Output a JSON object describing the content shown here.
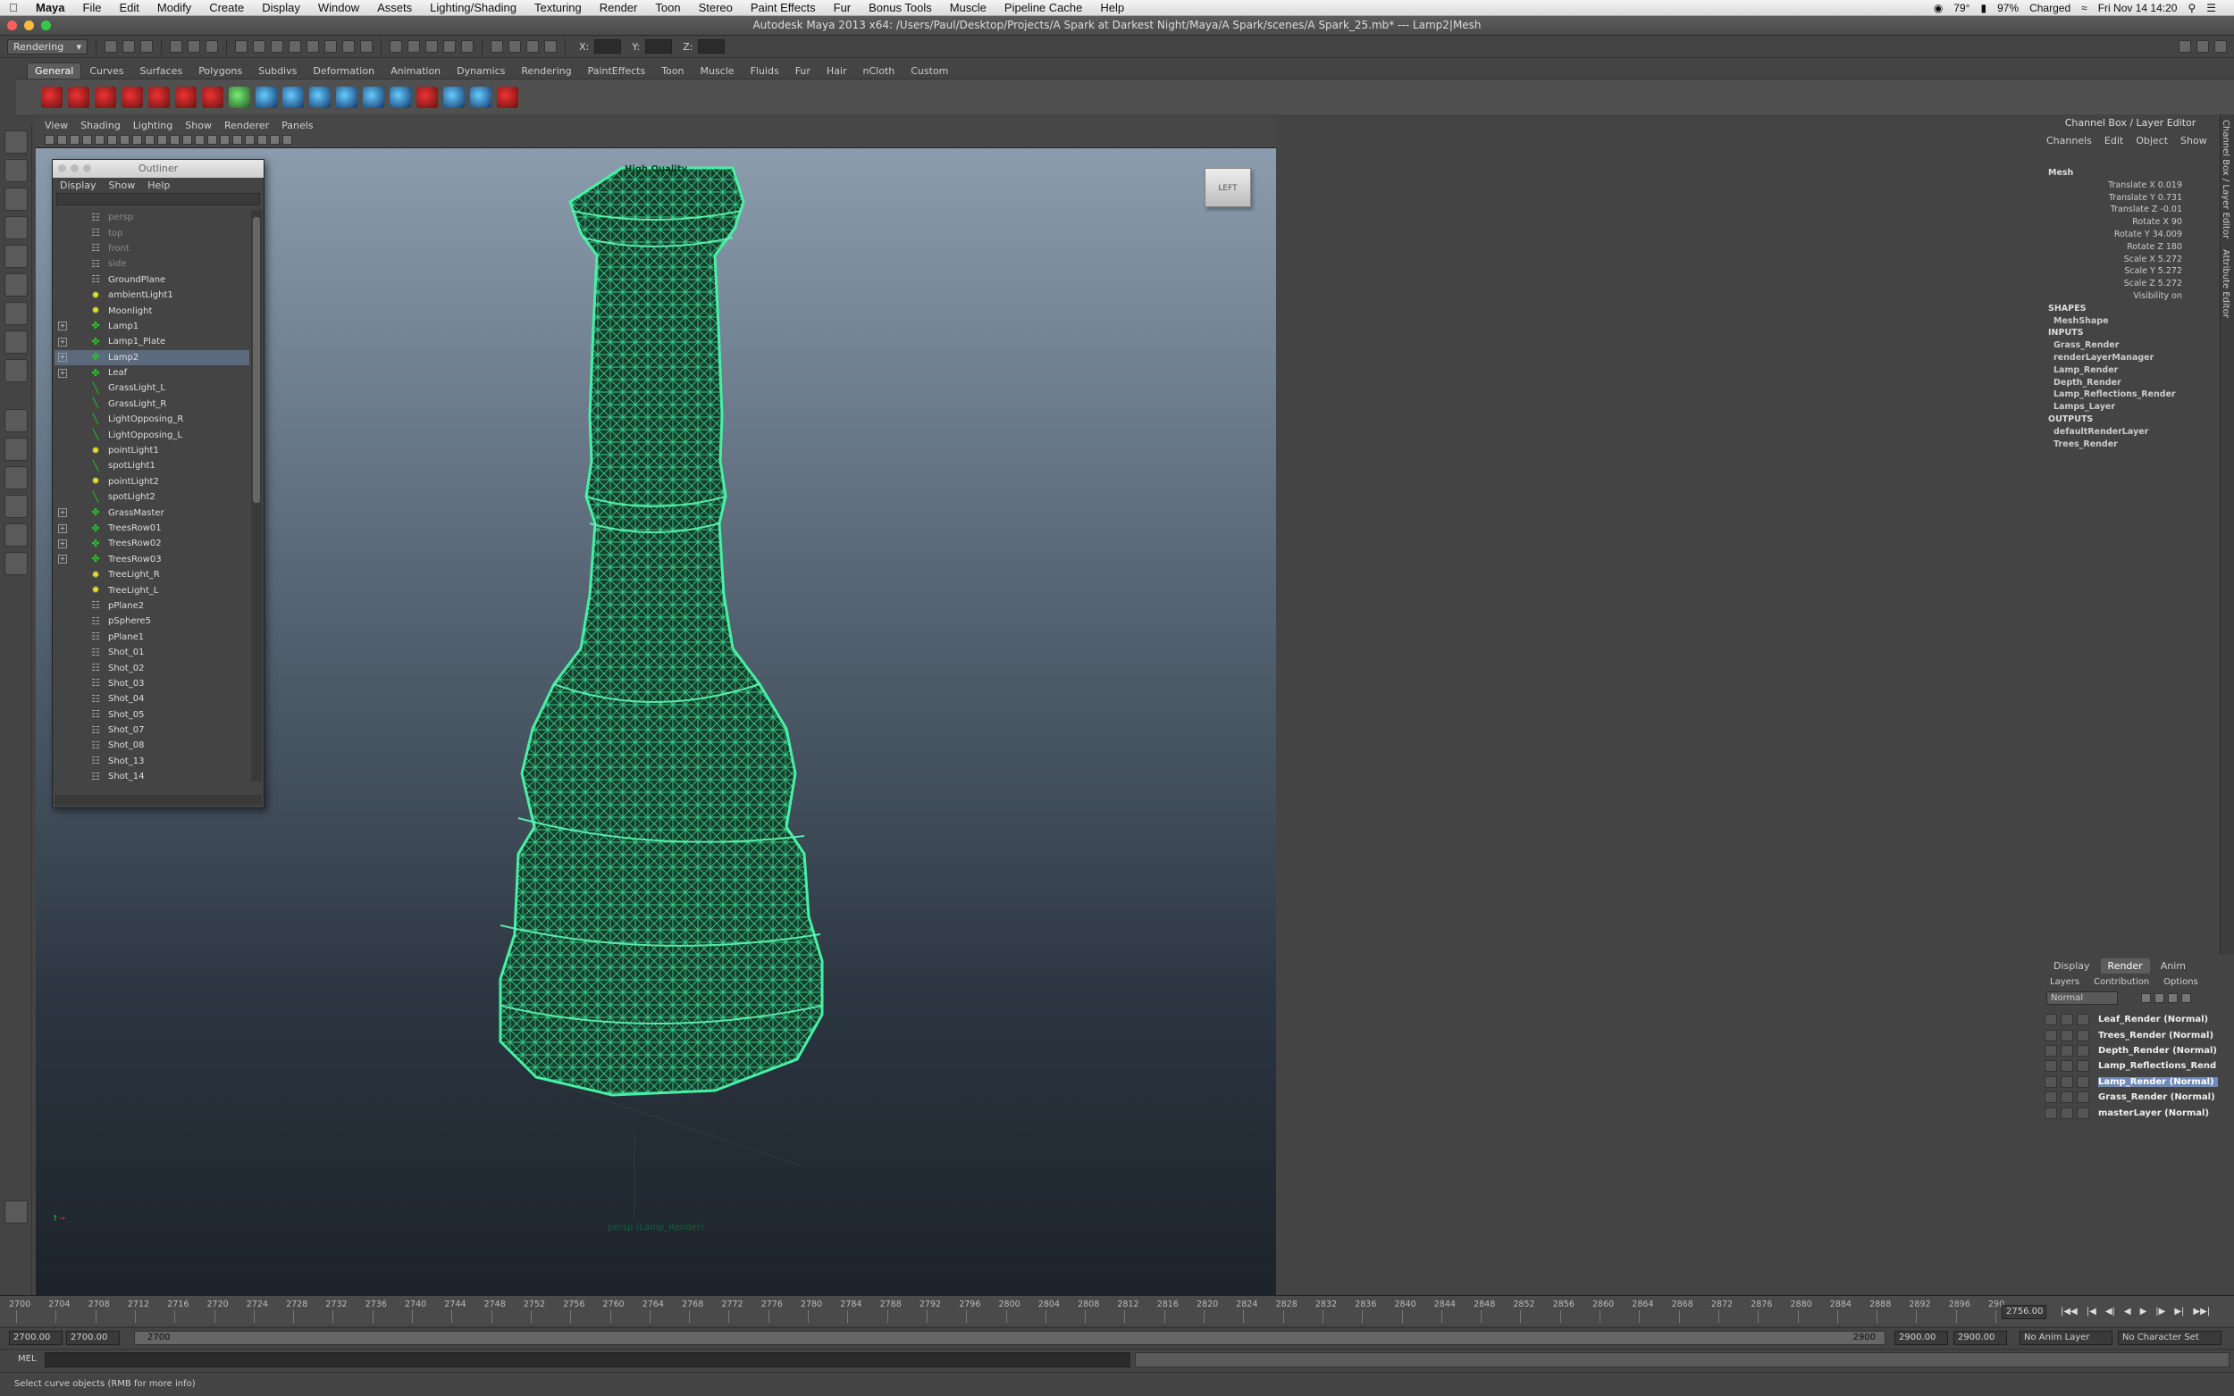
{
  "macos": {
    "app_name": "Maya",
    "menus": [
      "File",
      "Edit",
      "Modify",
      "Create",
      "Display",
      "Window",
      "Assets",
      "Lighting/Shading",
      "Texturing",
      "Render",
      "Toon",
      "Stereo",
      "Paint Effects",
      "Fur",
      "Bonus Tools",
      "Muscle",
      "Pipeline Cache",
      "Help"
    ],
    "temp": "79°",
    "battery": "97%",
    "battery_state": "Charged",
    "clock": "Fri Nov 14  14:20"
  },
  "window": {
    "title": "Autodesk Maya 2013 x64: /Users/Paul/Desktop/Projects/A Spark at Darkest Night/Maya/A Spark/scenes/A Spark_25.mb*   ---   Lamp2|Mesh",
    "colors": {
      "close": "#fc605c",
      "minimize": "#fdbc40",
      "zoom": "#34c84a"
    }
  },
  "status_line": {
    "menu_set": "Rendering",
    "x_label": "X:",
    "y_label": "Y:",
    "z_label": "Z:"
  },
  "shelf_tabs": [
    "General",
    "Curves",
    "Surfaces",
    "Polygons",
    "Subdivs",
    "Deformation",
    "Animation",
    "Dynamics",
    "Rendering",
    "PaintEffects",
    "Toon",
    "Muscle",
    "Fluids",
    "Fur",
    "Hair",
    "nCloth",
    "Custom"
  ],
  "viewport": {
    "menus": [
      "View",
      "Shading",
      "Lighting",
      "Show",
      "Renderer",
      "Panels"
    ],
    "hq_label": "High Quality",
    "viewcube_label": "LEFT",
    "camera_label": "persp (Lamp_Render)",
    "wire_color": "#3ee89a"
  },
  "outliner": {
    "title": "Outliner",
    "menus": [
      "Display",
      "Show",
      "Help"
    ],
    "items": [
      {
        "name": "persp",
        "icon": "cam",
        "exp": false,
        "dim": true
      },
      {
        "name": "top",
        "icon": "cam",
        "exp": false,
        "dim": true
      },
      {
        "name": "front",
        "icon": "cam",
        "exp": false,
        "dim": true
      },
      {
        "name": "side",
        "icon": "cam",
        "exp": false,
        "dim": true
      },
      {
        "name": "GroundPlane",
        "icon": "cam",
        "exp": false
      },
      {
        "name": "ambientLight1",
        "icon": "ylw",
        "exp": false
      },
      {
        "name": "Moonlight",
        "icon": "ylw",
        "exp": false
      },
      {
        "name": "Lamp1",
        "icon": "grp",
        "exp": true
      },
      {
        "name": "Lamp1_Plate",
        "icon": "grp",
        "exp": true
      },
      {
        "name": "Lamp2",
        "icon": "grp",
        "exp": true,
        "selected": true
      },
      {
        "name": "Leaf",
        "icon": "grp",
        "exp": true
      },
      {
        "name": "GrassLight_L",
        "icon": "lgt",
        "exp": false
      },
      {
        "name": "GrassLight_R",
        "icon": "lgt",
        "exp": false
      },
      {
        "name": "LightOpposing_R",
        "icon": "lgt",
        "exp": false
      },
      {
        "name": "LightOpposing_L",
        "icon": "lgt",
        "exp": false
      },
      {
        "name": "pointLight1",
        "icon": "ylw",
        "exp": false
      },
      {
        "name": "spotLight1",
        "icon": "lgt",
        "exp": false
      },
      {
        "name": "pointLight2",
        "icon": "ylw",
        "exp": false
      },
      {
        "name": "spotLight2",
        "icon": "lgt",
        "exp": false
      },
      {
        "name": "GrassMaster",
        "icon": "grp",
        "exp": true
      },
      {
        "name": "TreesRow01",
        "icon": "grp",
        "exp": true
      },
      {
        "name": "TreesRow02",
        "icon": "grp",
        "exp": true
      },
      {
        "name": "TreesRow03",
        "icon": "grp",
        "exp": true
      },
      {
        "name": "TreeLight_R",
        "icon": "ylw",
        "exp": false
      },
      {
        "name": "TreeLight_L",
        "icon": "ylw",
        "exp": false
      },
      {
        "name": "pPlane2",
        "icon": "cam",
        "exp": false
      },
      {
        "name": "pSphere5",
        "icon": "cam",
        "exp": false
      },
      {
        "name": "pPlane1",
        "icon": "cam",
        "exp": false
      },
      {
        "name": "Shot_01",
        "icon": "cam",
        "exp": false
      },
      {
        "name": "Shot_02",
        "icon": "cam",
        "exp": false
      },
      {
        "name": "Shot_03",
        "icon": "cam",
        "exp": false
      },
      {
        "name": "Shot_04",
        "icon": "cam",
        "exp": false
      },
      {
        "name": "Shot_05",
        "icon": "cam",
        "exp": false
      },
      {
        "name": "Shot_07",
        "icon": "cam",
        "exp": false
      },
      {
        "name": "Shot_08",
        "icon": "cam",
        "exp": false
      },
      {
        "name": "Shot_13",
        "icon": "cam",
        "exp": false
      },
      {
        "name": "Shot_14",
        "icon": "cam",
        "exp": false
      }
    ]
  },
  "channel_box": {
    "title": "Channel Box / Layer Editor",
    "menus": [
      "Channels",
      "Edit",
      "Object",
      "Show"
    ],
    "object": "Mesh",
    "attributes": [
      "Translate X 0.019",
      "Translate Y 0.731",
      "Translate Z -0.01",
      "Rotate X 90",
      "Rotate Y 34.009",
      "Rotate Z 180",
      "Scale X 5.272",
      "Scale Y 5.272",
      "Scale Z 5.272",
      "Visibility on"
    ],
    "shapes_label": "SHAPES",
    "shapes": [
      "MeshShape"
    ],
    "inputs_label": "INPUTS",
    "inputs": [
      "Grass_Render",
      "renderLayerManager",
      "Lamp_Render",
      "Depth_Render",
      "Lamp_Reflections_Render",
      "Lamps_Layer"
    ],
    "outputs_label": "OUTPUTS",
    "outputs": [
      "defaultRenderLayer",
      "Trees_Render"
    ],
    "side_tabs": [
      "Channel Box / Layer Editor",
      "Attribute Editor"
    ]
  },
  "layer_editor": {
    "tabs": [
      "Display",
      "Render",
      "Anim"
    ],
    "active_tab": "Render",
    "menus": [
      "Layers",
      "Contribution",
      "Options"
    ],
    "mode": "Normal",
    "layers": [
      {
        "name": "Leaf_Render (Normal)"
      },
      {
        "name": "Trees_Render (Normal)"
      },
      {
        "name": "Depth_Render (Normal)"
      },
      {
        "name": "Lamp_Reflections_Rend"
      },
      {
        "name": "Lamp_Render (Normal)",
        "selected": true
      },
      {
        "name": "Grass_Render (Normal)"
      },
      {
        "name": "masterLayer (Normal)"
      }
    ]
  },
  "timeline": {
    "ticks": [
      "2700",
      "2704",
      "2708",
      "2712",
      "2716",
      "2720",
      "2724",
      "2728",
      "2732",
      "2736",
      "2740",
      "2744",
      "2748",
      "2752",
      "2756",
      "2760",
      "2764",
      "2768",
      "2772",
      "2776",
      "2780",
      "2784",
      "2788",
      "2792",
      "2796",
      "2800",
      "2804",
      "2808",
      "2812",
      "2816",
      "2820",
      "2824",
      "2828",
      "2832",
      "2836",
      "2840",
      "2844",
      "2848",
      "2852",
      "2856",
      "2860",
      "2864",
      "2868",
      "2872",
      "2876",
      "2880",
      "2884",
      "2888",
      "2892",
      "2896",
      "290"
    ],
    "current_frame": "2756.00"
  },
  "range": {
    "start_anim": "2700.00",
    "start_playback": "2700.00",
    "bar_start": "2700",
    "bar_end": "2900",
    "end_playback": "2900.00",
    "end_anim": "2900.00",
    "anim_layer": "No Anim Layer",
    "character_set": "No Character Set"
  },
  "command_line": {
    "label": "MEL"
  },
  "help_line": {
    "text": "Select curve objects (RMB for more info)"
  }
}
